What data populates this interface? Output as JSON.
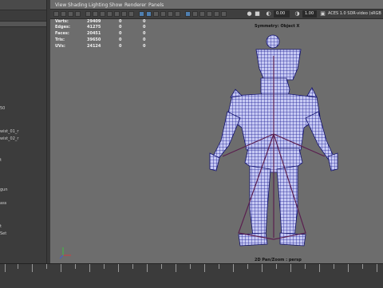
{
  "outliner": {
    "items": [
      {
        "label": "50"
      },
      {
        "label": "wist_01_r"
      },
      {
        "label": "wist_02_r"
      },
      {
        "label": "t"
      },
      {
        "label": "gun"
      },
      {
        "label": "ass"
      },
      {
        "label": "t"
      },
      {
        "label": "Set"
      }
    ]
  },
  "menubar": {
    "items": [
      "View",
      "Shading",
      "Lighting",
      "Show",
      "Renderer",
      "Panels"
    ]
  },
  "toolbar": {
    "exposure": "0.00",
    "gamma": "1.00",
    "colorspace": "ACES 1.0 SDR-video (sRGB"
  },
  "hud": {
    "rows": [
      {
        "label": "Verts:",
        "total": "29409",
        "sel1": "0",
        "sel2": "0"
      },
      {
        "label": "Edges:",
        "total": "41275",
        "sel1": "0",
        "sel2": "0"
      },
      {
        "label": "Faces:",
        "total": "20451",
        "sel1": "0",
        "sel2": "0"
      },
      {
        "label": "Tris:",
        "total": "39650",
        "sel1": "0",
        "sel2": "0"
      },
      {
        "label": "UVs:",
        "total": "24124",
        "sel1": "0",
        "sel2": "0"
      }
    ],
    "symmetry": "Symmetry: Object X",
    "camera": "2D Pan/Zoom : persp"
  },
  "colors": {
    "viewport_bg": "#6d6d6d",
    "wire": "#1a1a8c",
    "wire_highlight": "#c0c4ff",
    "bone": "#6a2a5a"
  }
}
